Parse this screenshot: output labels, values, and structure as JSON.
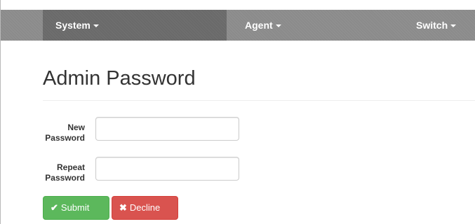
{
  "navbar": {
    "items": [
      {
        "label": "System"
      },
      {
        "label": "Agent"
      },
      {
        "label": "Switch"
      }
    ]
  },
  "page": {
    "title": "Admin Password"
  },
  "form": {
    "new_password": {
      "label_line1": "New",
      "label_line2": "Password",
      "value": ""
    },
    "repeat_password": {
      "label_line1": "Repeat",
      "label_line2": "Password",
      "value": ""
    }
  },
  "buttons": {
    "submit": {
      "label": "Submit",
      "icon": "check-icon",
      "icon_glyph": "✔",
      "color": "#5cb85c"
    },
    "decline": {
      "label": "Decline",
      "icon": "times-icon",
      "icon_glyph": "✖",
      "color": "#d9534f"
    }
  },
  "colors": {
    "navbar_bg": "#8b8b8b",
    "navbar_active_bg": "#6a6a6a",
    "title_text": "#333333"
  }
}
